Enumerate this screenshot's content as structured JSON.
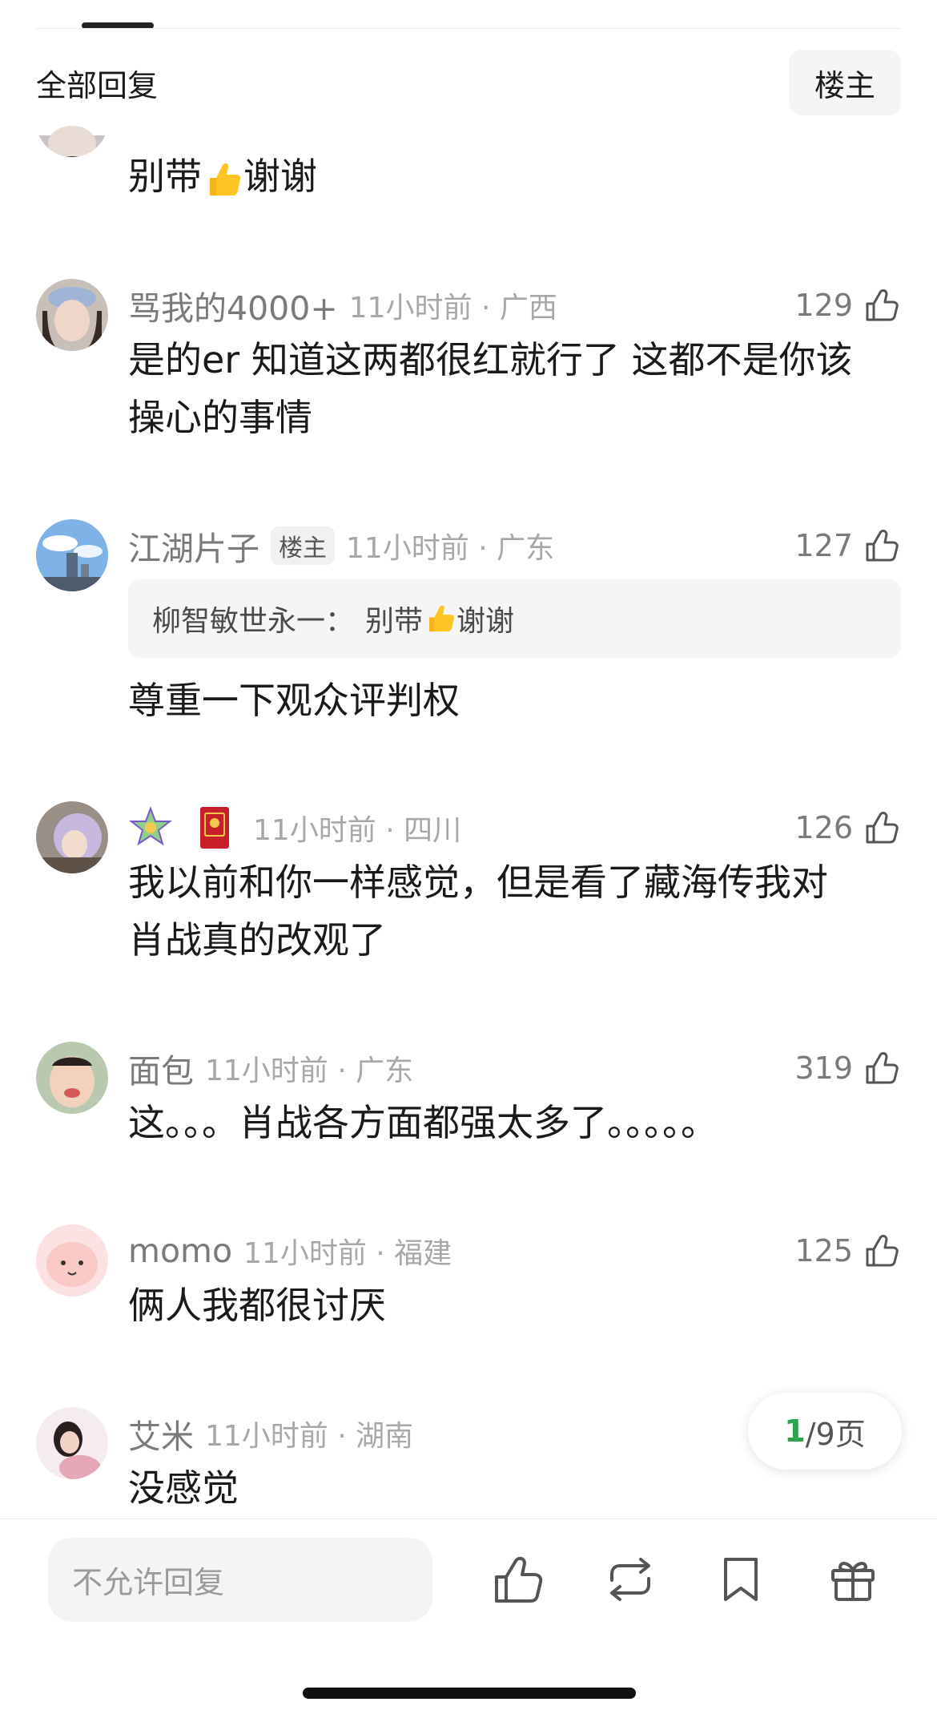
{
  "header": {
    "title": "全部回复",
    "owner_filter": "楼主"
  },
  "comments": [
    {
      "text": "别带👍谢谢"
    },
    {
      "username": "骂我的4000+",
      "meta": "11小时前 · 广西",
      "likes": "129",
      "text_line1": "是的er 知道这两都很红就行了 这都不是你该",
      "text_line2": "操心的事情"
    },
    {
      "username": "江湖片子",
      "badge": "楼主",
      "meta": "11小时前 · 广东",
      "likes": "127",
      "quote_author": "柳智敏世永一：",
      "quote_text_a": "别带",
      "quote_text_b": "谢谢",
      "text": "尊重一下观众评判权"
    },
    {
      "meta": "11小时前 · 四川",
      "likes": "126",
      "text_line1": "我以前和你一样感觉，但是看了藏海传我对",
      "text_line2": "肖战真的改观了"
    },
    {
      "username": "面包",
      "meta": "11小时前 · 广东",
      "likes": "319",
      "text": "这。。。肖战各方面都强太多了。。。。。"
    },
    {
      "username": "momo",
      "meta": "11小时前 · 福建",
      "likes": "125",
      "text": "俩人我都很讨厌"
    },
    {
      "username": "艾米",
      "meta": "11小时前 · 湖南",
      "text": "没感觉"
    }
  ],
  "page_indicator": {
    "current": "1",
    "rest": "/9页"
  },
  "bottom_bar": {
    "reply_placeholder": "不允许回复"
  },
  "icons": [
    "thumb-up-icon",
    "repost-icon",
    "bookmark-icon",
    "gift-icon"
  ],
  "colors": {
    "accent_green": "#2ea44f",
    "meta_gray": "#a8a8a8"
  }
}
